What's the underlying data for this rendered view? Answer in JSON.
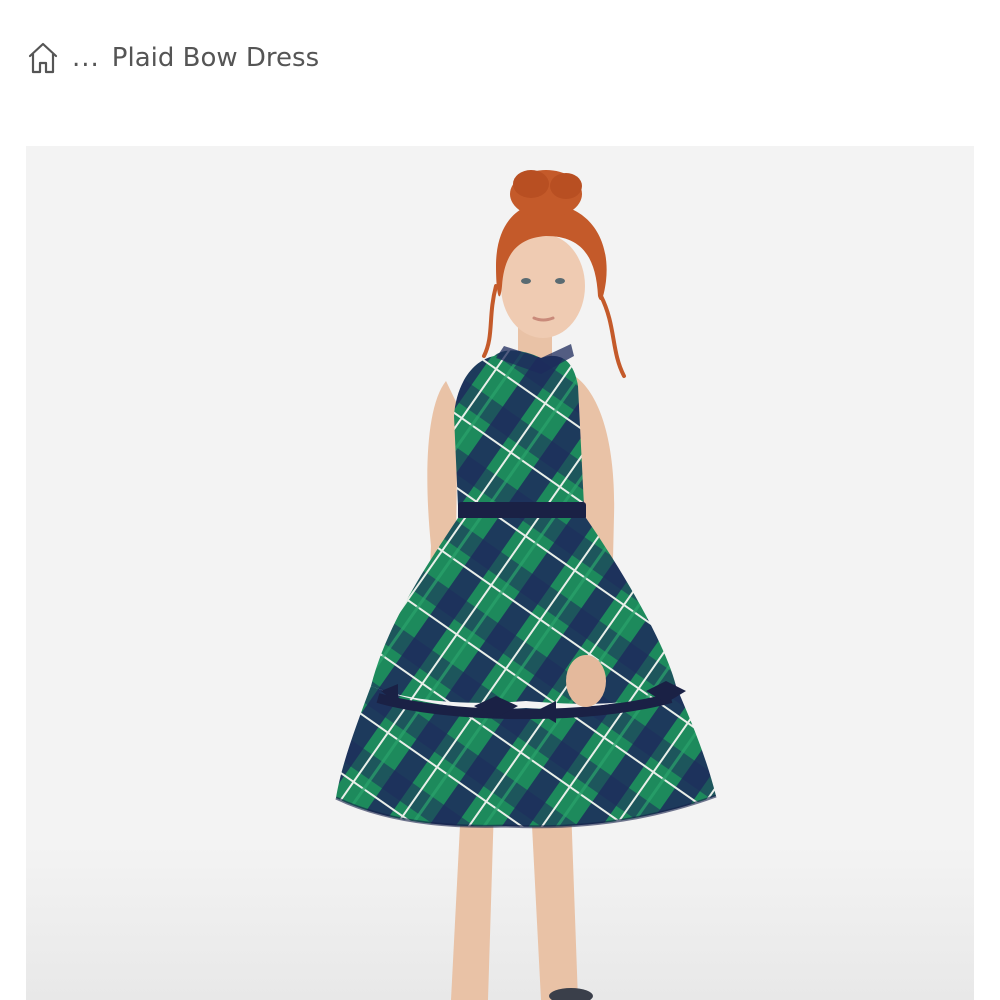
{
  "breadcrumb": {
    "home_icon": "home-icon",
    "ellipsis": "...",
    "current": "Plaid Bow Dress"
  },
  "product_image": {
    "subject": "Plaid Bow Dress"
  },
  "colors": {
    "breadcrumb_text": "#555555",
    "photo_background": "#f3f3f3",
    "plaid_green": "#1d8a5c",
    "plaid_navy": "#1d2b5c",
    "hair": "#c45a2a"
  }
}
